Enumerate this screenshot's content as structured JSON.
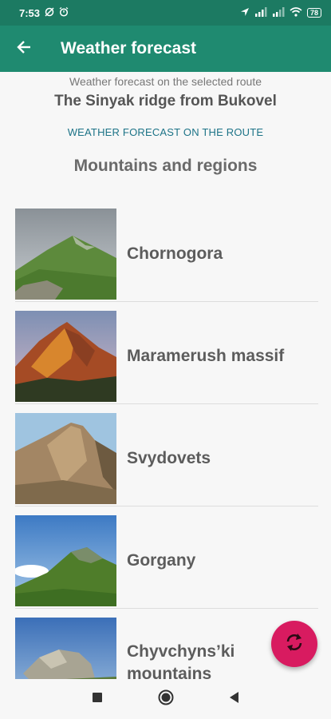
{
  "status_bar": {
    "time": "7:53",
    "battery": "78"
  },
  "app_bar": {
    "title": "Weather forecast"
  },
  "route": {
    "caption": "Weather forecast on the selected route",
    "name": "The Sinyak ridge from Bukovel",
    "link_label": "WEATHER FORECAST ON THE ROUTE"
  },
  "section": {
    "title": "Mountains and regions"
  },
  "regions": [
    {
      "label": "Chornogora"
    },
    {
      "label": "Maramerush massif"
    },
    {
      "label": "Svydovets"
    },
    {
      "label": "Gorgany"
    },
    {
      "label": "Chyvchyns’ki mountains"
    }
  ],
  "fab": {
    "icon": "refresh-icon",
    "color": "#d81b60"
  },
  "colors": {
    "status_bar": "#1c7a62",
    "app_bar": "#1f8a70",
    "link": "#1c7387"
  }
}
